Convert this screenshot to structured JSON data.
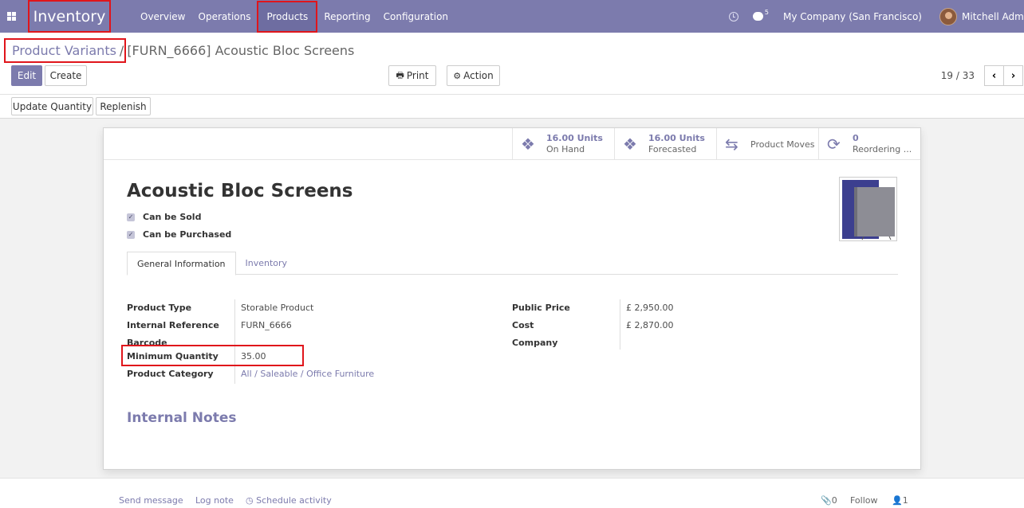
{
  "navbar": {
    "app_name": "Inventory",
    "menu": [
      "Overview",
      "Operations",
      "Products",
      "Reporting",
      "Configuration"
    ],
    "active_menu": "Products",
    "message_count": "5",
    "company": "My Company (San Francisco)",
    "user": "Mitchell Admin"
  },
  "breadcrumb": {
    "parent": "Product Variants",
    "separator": "/",
    "current": "[FURN_6666] Acoustic Bloc Screens"
  },
  "toolbar": {
    "edit_label": "Edit",
    "create_label": "Create",
    "print_label": "Print",
    "action_label": "Action",
    "pager": "19 / 33",
    "update_quantity_label": "Update Quantity",
    "replenish_label": "Replenish"
  },
  "smart_buttons": [
    {
      "value": "16.00 Units",
      "label": "On Hand",
      "icon": "cubes-icon"
    },
    {
      "value": "16.00 Units",
      "label": "Forecasted",
      "icon": "cubes-icon"
    },
    {
      "value": "",
      "label": "Product Moves",
      "icon": "exchange-icon"
    },
    {
      "value": "0",
      "label": "Reordering ...",
      "icon": "refresh-icon"
    }
  ],
  "product": {
    "name": "Acoustic Bloc Screens",
    "can_be_sold": "Can be Sold",
    "can_be_purchased": "Can be Purchased"
  },
  "tabs": [
    "General Information",
    "Inventory"
  ],
  "fields_left": [
    {
      "label": "Product Type",
      "value": "Storable Product"
    },
    {
      "label": "Internal Reference",
      "value": "FURN_6666"
    },
    {
      "label": "Barcode",
      "value": ""
    },
    {
      "label": "Minimum Quantity",
      "value": "35.00"
    },
    {
      "label": "Product Category",
      "value": "All / Saleable / Office Furniture"
    }
  ],
  "fields_right": [
    {
      "label": "Public Price",
      "value": "£ 2,950.00"
    },
    {
      "label": "Cost",
      "value": "£ 2,870.00"
    },
    {
      "label": "Company",
      "value": ""
    }
  ],
  "notes_title": "Internal Notes",
  "chatter": {
    "send_message": "Send message",
    "log_note": "Log note",
    "schedule_activity": "Schedule activity",
    "attachments": "0",
    "follow": "Follow",
    "followers": "1"
  },
  "colors": {
    "brand": "#7c7bad",
    "highlight": "#e0151b"
  }
}
